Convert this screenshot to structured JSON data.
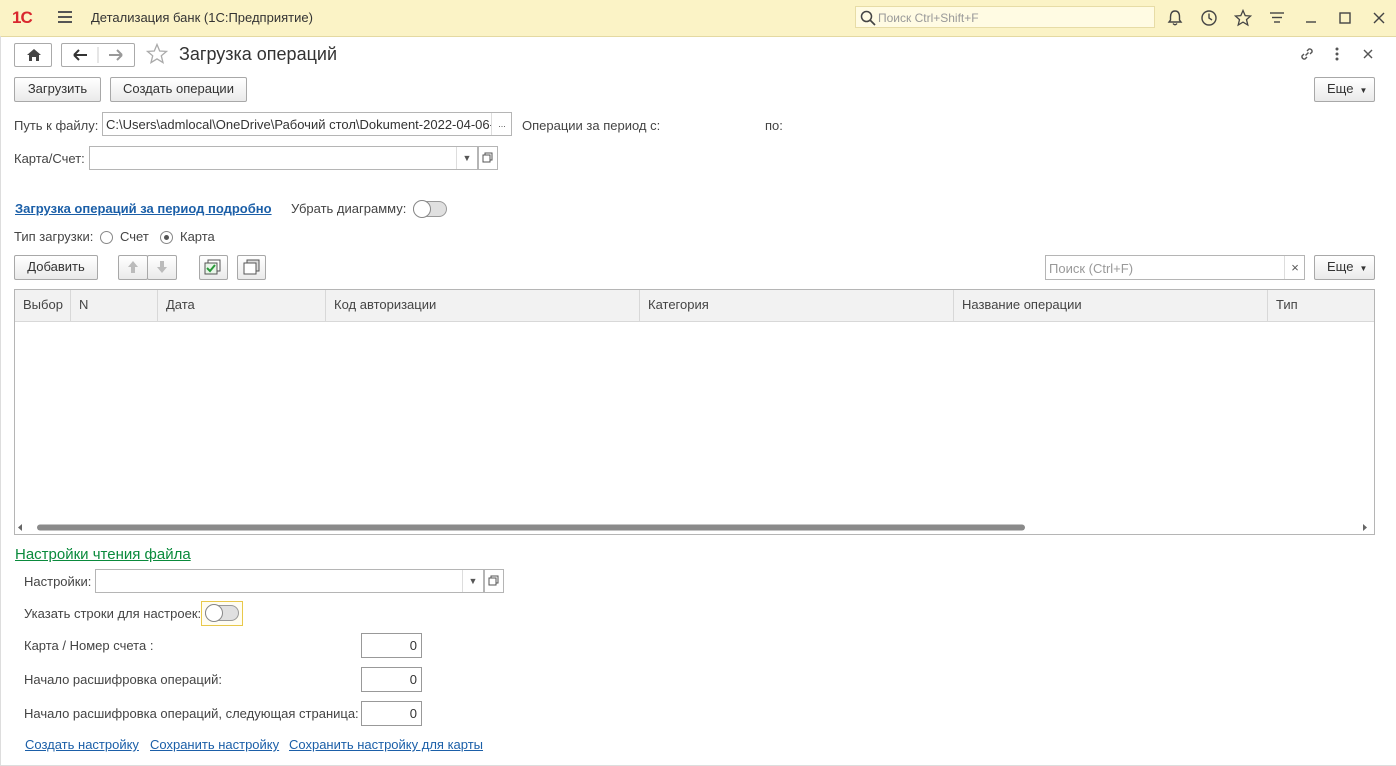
{
  "app": {
    "logo": "1С",
    "title": "Детализация банк  (1С:Предприятие)",
    "search_placeholder": "Поиск Ctrl+Shift+F"
  },
  "form": {
    "title": "Загрузка операций",
    "load_button": "Загрузить",
    "create_ops_button": "Создать операции",
    "more_button": "Еще",
    "file_path_label": "Путь к файлу:",
    "file_path_value": "C:\\Users\\admlocal\\OneDrive\\Рабочий стол\\Dokument-2022-04-06-",
    "browse_button": "...",
    "period_from_label": "Операции за период с:",
    "period_to_label": "по:",
    "card_account_label": "Карта/Счет:",
    "card_account_value": "",
    "detailed_link": "Загрузка операций за период подробно",
    "hide_chart_label": "Убрать диаграмму:",
    "load_type_label": "Тип загрузки:",
    "load_type_options": [
      "Счет",
      "Карта"
    ],
    "load_type_selected": "Карта"
  },
  "table_toolbar": {
    "add_button": "Добавить",
    "search_placeholder": "Поиск (Ctrl+F)",
    "clear_button": "×",
    "more_button": "Еще"
  },
  "table": {
    "columns": [
      "Выбор",
      "N",
      "Дата",
      "Код авторизации",
      "Категория",
      "Название операции",
      "Тип"
    ],
    "rows": []
  },
  "settings": {
    "title": "Настройки чтения файла",
    "settings_label": "Настройки:",
    "settings_value": "",
    "specify_rows_label": "Указать строки для настроек:",
    "card_number_label": "Карта / Номер счета :",
    "card_number_value": "0",
    "ops_start_label": "Начало расшифровка операций:",
    "ops_start_value": "0",
    "ops_next_label": "Начало расшифровка операций, следующая страница:",
    "ops_next_value": "0",
    "create_link": "Создать настройку",
    "save_link": "Сохранить настройку",
    "save_card_link": "Сохранить настройку для карты"
  }
}
